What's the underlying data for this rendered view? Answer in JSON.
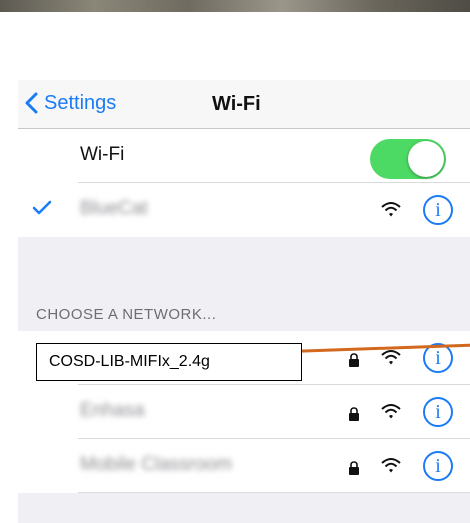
{
  "navbar": {
    "back_label": "Settings",
    "title": "Wi-Fi"
  },
  "wifi_toggle": {
    "label": "Wi-Fi",
    "state": "on",
    "accent_color": "#4cd964"
  },
  "connected_network": {
    "name": "BlueCat",
    "selected": true
  },
  "section_header": "CHOOSE A NETWORK...",
  "networks": [
    {
      "name": "COSD-LIB-MIFIx_2.4g",
      "locked": true
    },
    {
      "name": "Enhasa",
      "locked": true
    },
    {
      "name": "Mobile Classroom",
      "locked": true
    }
  ],
  "annotation": {
    "callout_text": "COSD-LIB-MIFIx_2.4g"
  },
  "icons": {
    "info": "i"
  },
  "colors": {
    "ios_blue": "#1a7cf5",
    "callout_line": "#d2691e"
  }
}
